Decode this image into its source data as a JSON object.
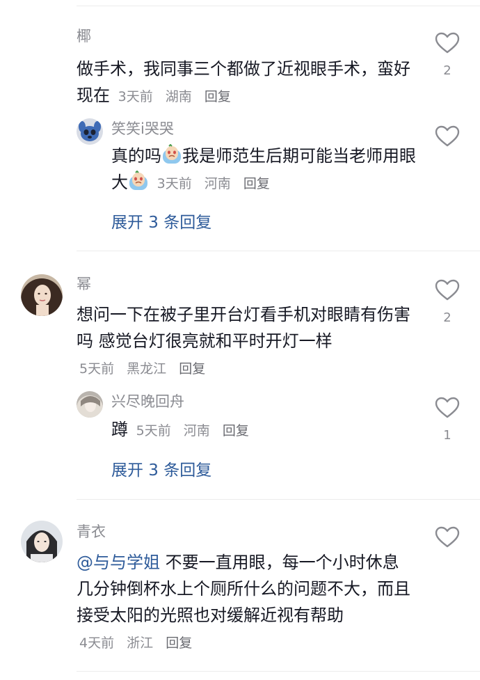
{
  "comments": [
    {
      "name": "椰",
      "text": "做手术，我同事三个都做了近视眼手术，蛮好现在",
      "time": "3天前",
      "location": "湖南",
      "reply_label": "回复",
      "likes": "2",
      "replies": [
        {
          "name": "笑笑i哭哭",
          "text_a": "真的吗",
          "text_b": "我是师范生后期可能当老师用眼大",
          "time": "3天前",
          "location": "河南",
          "reply_label": "回复",
          "likes": "",
          "emoji": "crying-face-emoji"
        }
      ],
      "expand_label": "展开 3 条回复"
    },
    {
      "name": "幂",
      "text": "想问一下在被子里开台灯看手机对眼睛有伤害吗 感觉台灯很亮就和平时开灯一样",
      "time": "5天前",
      "location": "黑龙江",
      "reply_label": "回复",
      "likes": "2",
      "replies": [
        {
          "name": "兴尽晚回舟",
          "text": "蹲",
          "time": "5天前",
          "location": "河南",
          "reply_label": "回复",
          "likes": "1"
        }
      ],
      "expand_label": "展开 3 条回复"
    },
    {
      "name": "青衣",
      "mention": "@与与学姐",
      "text": "不要一直用眼，每一个小时休息几分钟倒杯水上个厕所什么的问题不大，而且接受太阳的光照也对缓解近视有帮助",
      "time": "4天前",
      "location": "浙江",
      "reply_label": "回复",
      "likes": ""
    }
  ],
  "icons": {
    "like": "heart-outline-icon"
  },
  "colors": {
    "link": "#2e5b9a",
    "secondary": "#8a8b91",
    "primary": "#161823"
  }
}
